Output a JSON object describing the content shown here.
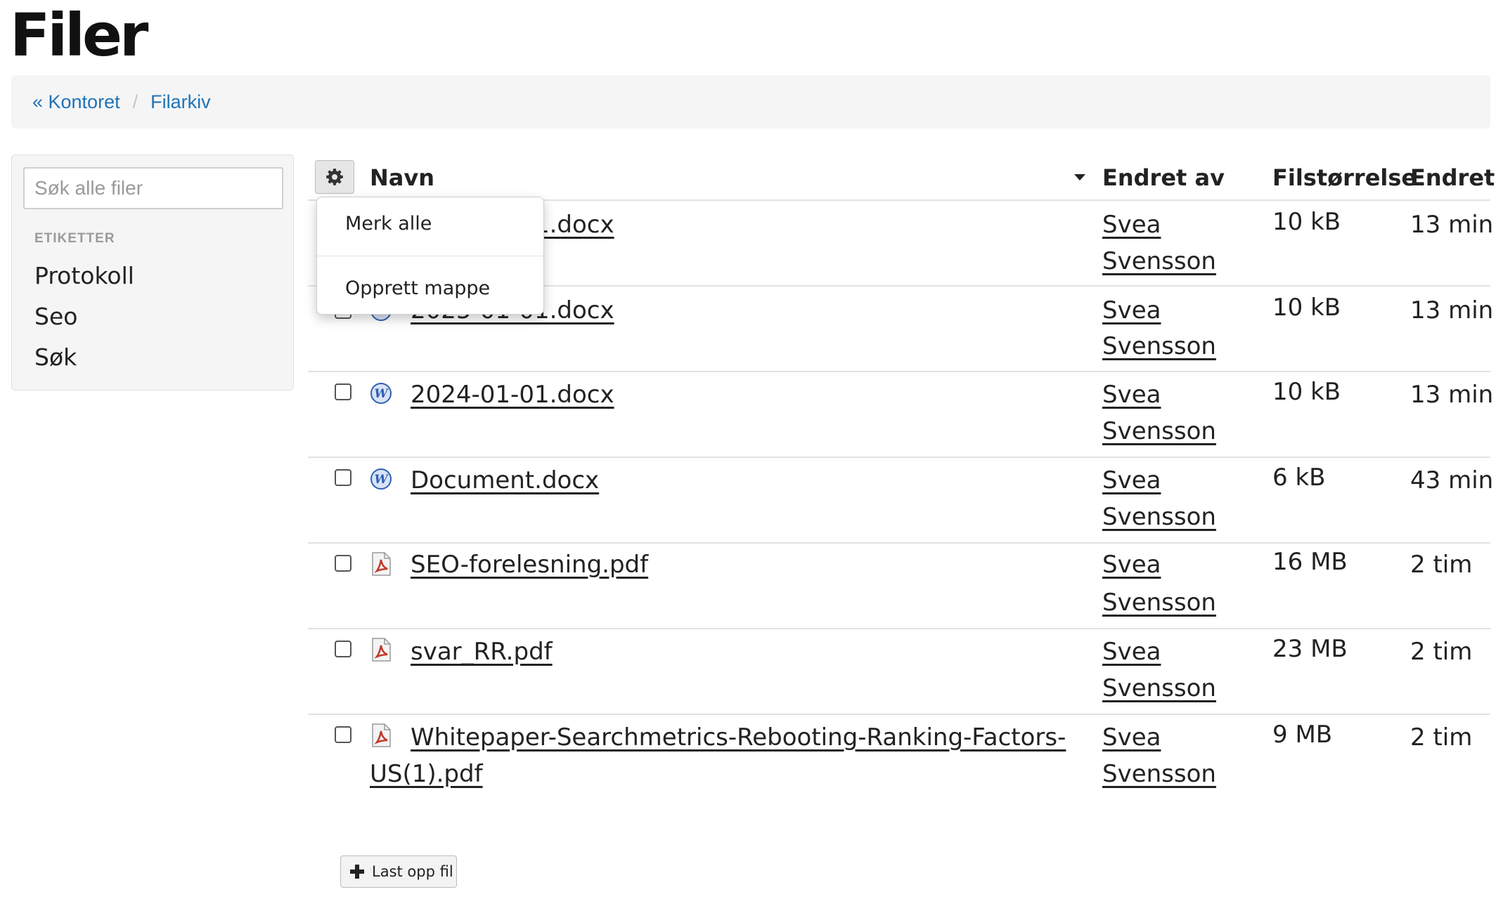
{
  "page": {
    "title": "Filer"
  },
  "breadcrumb": {
    "items": [
      "« Kontoret",
      "Filarkiv"
    ],
    "separator": "/"
  },
  "sidebar": {
    "search_placeholder": "Søk alle filer",
    "tags_heading": "ETIKETTER",
    "tags": [
      "Protokoll",
      "Seo",
      "Søk"
    ]
  },
  "table": {
    "columns": {
      "name": "Navn",
      "modified_by": "Endret av",
      "size": "Filstørrelse",
      "modified": "Endret"
    },
    "rows": [
      {
        "name": "2025-01-01.docx",
        "type": "word",
        "author_first": "Svea",
        "author_last": "Svensson",
        "size": "10 kB",
        "modified": "13 min"
      },
      {
        "name": "2025-01-01.docx",
        "type": "word",
        "author_first": "Svea",
        "author_last": "Svensson",
        "size": "10 kB",
        "modified": "13 min"
      },
      {
        "name": "2024-01-01.docx",
        "type": "word",
        "author_first": "Svea",
        "author_last": "Svensson",
        "size": "10 kB",
        "modified": "13 min"
      },
      {
        "name": "Document.docx",
        "type": "word",
        "author_first": "Svea",
        "author_last": "Svensson",
        "size": "6 kB",
        "modified": "43 min"
      },
      {
        "name": "SEO-forelesning.pdf",
        "type": "pdf",
        "author_first": "Svea",
        "author_last": "Svensson",
        "size": "16 MB",
        "modified": "2 tim"
      },
      {
        "name": "svar_RR.pdf",
        "type": "pdf",
        "author_first": "Svea",
        "author_last": "Svensson",
        "size": "23 MB",
        "modified": "2 tim"
      },
      {
        "name_line1": "Whitepaper-Searchmetrics-Rebooting-Ranking-Factors-",
        "name_line2": "US(1).pdf",
        "type": "pdf",
        "author_first": "Svea",
        "author_last": "Svensson",
        "size": "9 MB",
        "modified": "2 tim"
      }
    ]
  },
  "menu": {
    "items": [
      "Merk alle",
      "Opprett mappe"
    ]
  },
  "upload": {
    "label": "Last opp fil"
  },
  "colors": {
    "link": "#1f73b7",
    "panel": "#f5f5f5",
    "word_icon": "#2f5fb3",
    "pdf_icon": "#c0392b"
  },
  "icons": {
    "gear": "gear-icon",
    "word": "word-document-icon",
    "pdf": "pdf-document-icon",
    "plus": "plus-icon"
  }
}
